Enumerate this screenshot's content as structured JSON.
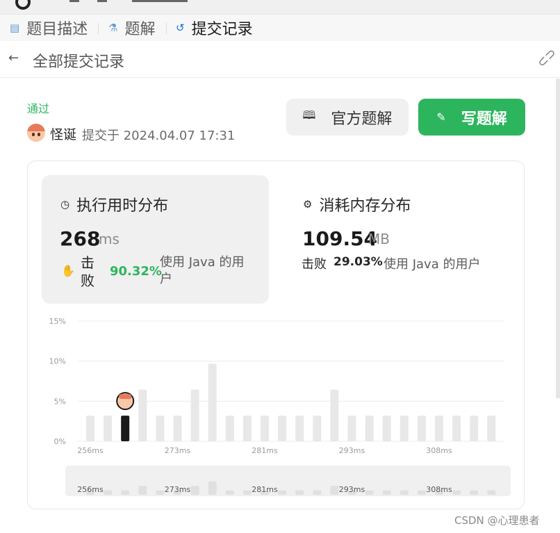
{
  "tabs": [
    {
      "label": "题目描述",
      "icon": "document-icon",
      "active": false
    },
    {
      "label": "题解",
      "icon": "flask-icon",
      "active": false
    },
    {
      "label": "提交记录",
      "icon": "history-icon",
      "active": true
    }
  ],
  "header": {
    "title": "全部提交记录"
  },
  "submission": {
    "status": "通过",
    "username": "怪诞",
    "submitted_text": "提交于 2024.04.07 17:31"
  },
  "buttons": {
    "official_solution": "官方题解",
    "write_solution": "写题解"
  },
  "runtime": {
    "title": "执行用时分布",
    "value": "268",
    "unit": "ms",
    "beat_label": "击败",
    "percent": "90.32%",
    "description": "使用 Java 的用户"
  },
  "memory": {
    "title": "消耗内存分布",
    "value": "109.54",
    "unit": "MB",
    "beat_label": "击败",
    "percent": "29.03%",
    "description": "使用 Java 的用户"
  },
  "chart_data": {
    "type": "bar",
    "y_tick_labels": [
      "15%",
      "10%",
      "5%",
      "0%"
    ],
    "ylim": [
      0,
      15
    ],
    "x_tick_labels": [
      "256ms",
      "273ms",
      "281ms",
      "293ms",
      "308ms"
    ],
    "values": [
      3.2,
      3.2,
      3.2,
      6.45,
      3.2,
      3.2,
      6.45,
      9.68,
      3.2,
      3.2,
      3.2,
      3.2,
      3.2,
      3.2,
      6.45,
      3.2,
      3.2,
      3.2,
      3.2,
      3.2,
      3.2,
      3.2,
      3.2,
      3.2
    ],
    "highlight_index": 2,
    "colors": {
      "bar": "#e8e8e8",
      "highlight": "#1a1a1a",
      "grid": "#ececec",
      "overview_bg": "#f0f0f0",
      "overview_bar": "#e0e0e0"
    }
  },
  "watermark": "CSDN @心理患者"
}
